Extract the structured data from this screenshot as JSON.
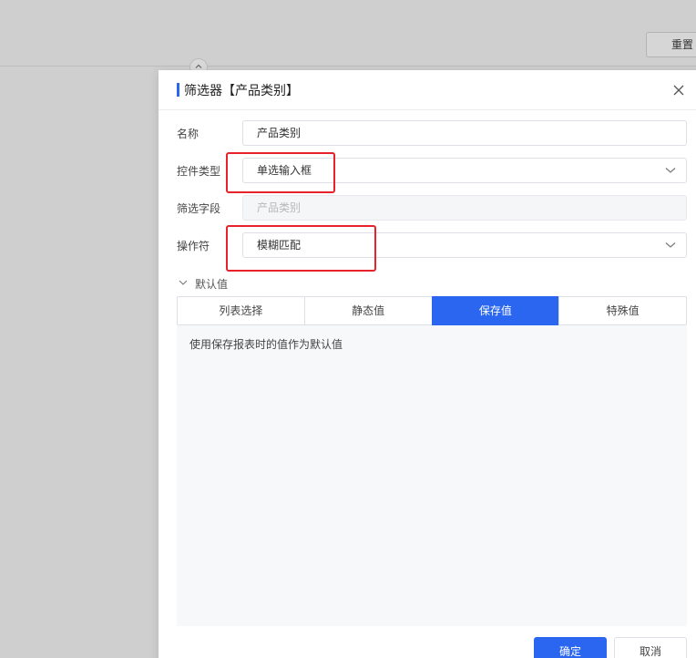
{
  "background": {
    "reset_label": "重置"
  },
  "dialog": {
    "title": "筛选器【产品类别】",
    "fields": {
      "name_label": "名称",
      "name_value": "产品类别",
      "control_type_label": "控件类型",
      "control_type_value": "单选输入框",
      "filter_field_label": "筛选字段",
      "filter_field_value": "产品类别",
      "operator_label": "操作符",
      "operator_value": "模糊匹配"
    },
    "default_section": {
      "label": "默认值",
      "tabs": [
        "列表选择",
        "静态值",
        "保存值",
        "特殊值"
      ],
      "active_tab": "保存值",
      "panel_text": "使用保存报表时的值作为默认值"
    },
    "footer": {
      "ok_label": "确定",
      "cancel_label": "取消"
    }
  },
  "colors": {
    "accent": "#2a66f0",
    "highlight": "#e8222b"
  },
  "icons": [
    "close-icon",
    "chevron-down-icon",
    "chevron-up-icon",
    "collapse-chevron-icon"
  ]
}
